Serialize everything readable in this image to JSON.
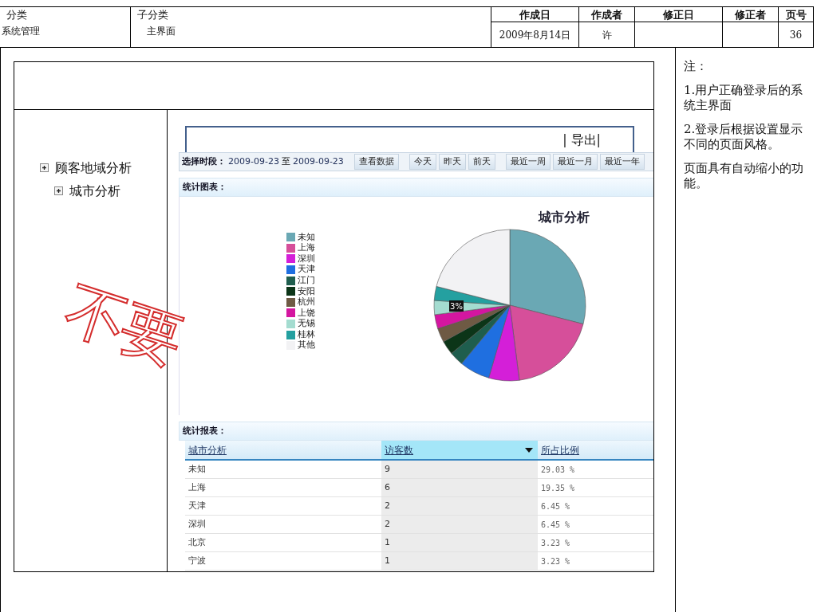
{
  "doc_header": {
    "fields": [
      {
        "label": "分类",
        "value": "系统管理"
      },
      {
        "label": "子分类",
        "value": "主界面"
      },
      {
        "label": "作成日",
        "value": "2009年8月14日"
      },
      {
        "label": "作成者",
        "value": "许"
      },
      {
        "label": "修正日"
      },
      {
        "label": "修正者"
      },
      {
        "label": "页号",
        "value": "36"
      }
    ]
  },
  "tree": [
    {
      "label": "顾客地域分析",
      "children": [
        {
          "label": "城市分析"
        }
      ]
    }
  ],
  "export_bar": {
    "label": "| 导出|"
  },
  "toolbar": {
    "label": "选择时段：",
    "date_from": "2009-09-23",
    "separator": "至",
    "date_to": "2009-09-23",
    "buttons": [
      "查看数据",
      "今天",
      "昨天",
      "前天",
      "最近一周",
      "最近一月",
      "最近一年"
    ]
  },
  "chart_section": {
    "title": "统计图表：",
    "chart_title": "城市分析",
    "slice_label": "3%",
    "legend": [
      {
        "label": "未知",
        "color": "#6aa8b4"
      },
      {
        "label": "上海",
        "color": "#d64f9a"
      },
      {
        "label": "深圳",
        "color": "#d41fd8"
      },
      {
        "label": "天津",
        "color": "#1f6fe0"
      },
      {
        "label": "江门",
        "color": "#1f5e4e"
      },
      {
        "label": "安阳",
        "color": "#0c3518"
      },
      {
        "label": "杭州",
        "color": "#6e5a44"
      },
      {
        "label": "上饶",
        "color": "#d416a0"
      },
      {
        "label": "无锡",
        "color": "#a4dcd0"
      },
      {
        "label": "桂林",
        "color": "#24a0a0"
      },
      {
        "label": "其他",
        "color": "#f2f2f4"
      }
    ]
  },
  "report_section": {
    "title": "统计报表：",
    "columns": [
      {
        "label": "城市分析",
        "sorted": false
      },
      {
        "label": "访客数",
        "sorted": true
      },
      {
        "label": "所占比例",
        "sorted": false
      }
    ],
    "rows": [
      [
        "未知",
        "9",
        "29.03 %"
      ],
      [
        "上海",
        "6",
        "19.35 %"
      ],
      [
        "天津",
        "2",
        "6.45 %"
      ],
      [
        "深圳",
        "2",
        "6.45 %"
      ],
      [
        "北京",
        "1",
        "3.23 %"
      ],
      [
        "宁波",
        "1",
        "3.23 %"
      ]
    ]
  },
  "notes": {
    "title": "注：",
    "items": [
      "1.用户正确登录后的系统主界面",
      "2.登录后根据设置显示不同的页面风格。",
      "页面具有自动缩小的功能。"
    ]
  },
  "stamp": "不要"
}
